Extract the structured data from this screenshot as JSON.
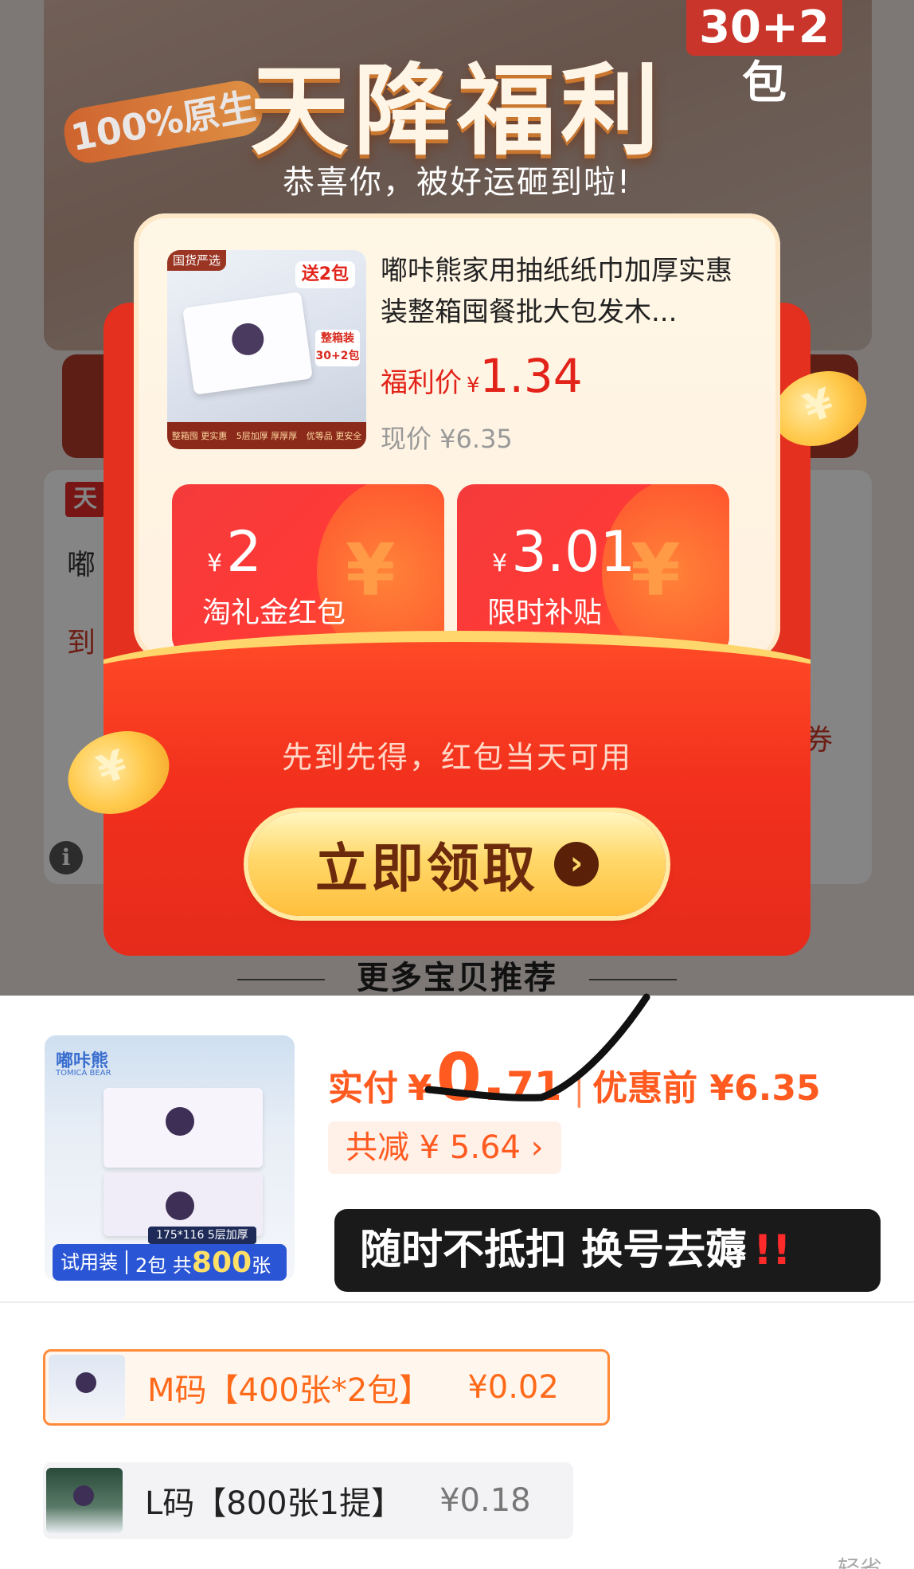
{
  "popup": {
    "headline": "天降福利",
    "subhead": "恭喜你，被好运砸到啦!",
    "badge": "30+2包",
    "flame_text": "100%原生",
    "product": {
      "title": "嘟咔熊家用抽纸纸巾加厚实惠装整箱囤餐批大包发木...",
      "image_tag_left": "国货严选",
      "image_tag_right": "送2包",
      "image_pkg_tag": "整箱装 30+2包",
      "image_strip": [
        "整箱囤 更实惠",
        "5层加厚 厚厚厚",
        "优等品 更安全"
      ],
      "welfare_label": "福利价",
      "welfare_currency": "¥",
      "welfare_price": "1.34",
      "current_price": "现价 ¥6.35"
    },
    "coupons": [
      {
        "currency": "¥",
        "amount": "2",
        "desc": "淘礼金红包"
      },
      {
        "currency": "¥",
        "amount": "3.01",
        "desc": "限时补贴"
      }
    ],
    "note": "先到先得，红包当天可用",
    "claim_label": "立即领取",
    "claim_arrow": "›"
  },
  "background": {
    "tag": "天",
    "ghost_1": "嘟",
    "ghost_2": "到",
    "ghost_3": "券",
    "section_title": "更多宝贝推荐"
  },
  "product": {
    "brand": "嘟咔熊",
    "brand_sub": "TOMICA BEAR",
    "spec": "175*116 5层加厚",
    "trial_label": "试用装",
    "trial_prefix": "2包 共",
    "trial_count": "800",
    "trial_unit": "张",
    "paid_label": "实付",
    "paid_currency": "¥",
    "paid_int": "0.",
    "paid_dec": "71",
    "separator": "|",
    "before_price": "优惠前 ¥6.35",
    "save_label": "共减 ¥ 5.64 ›",
    "banner_text": "随时不抵扣 换号去薅",
    "banner_bang": "!!"
  },
  "skus": [
    {
      "name": "M码【400张*2包】",
      "price": "¥0.02",
      "selected": true
    },
    {
      "name": "L码【800张1提】",
      "price": "¥0.18",
      "selected": false
    }
  ],
  "corner_text": "轻省",
  "colors": {
    "brand_red": "#e2231a",
    "accent_orange": "#ff5a1f",
    "envelope_red": "#e3301f",
    "button_gold": "#ffd86a"
  }
}
